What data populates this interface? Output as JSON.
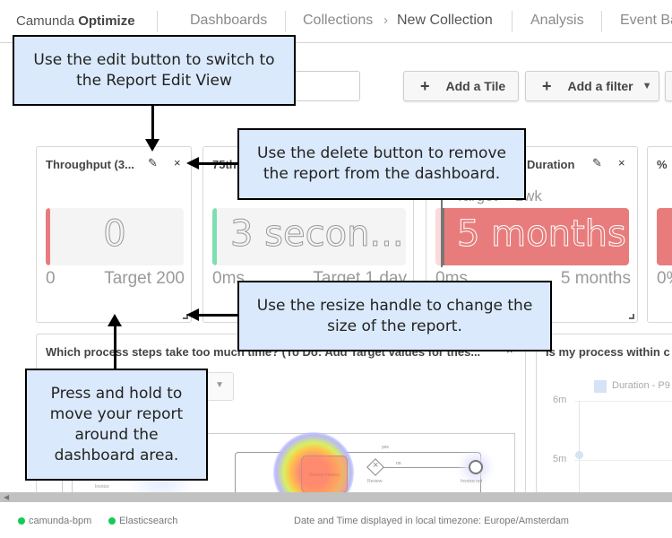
{
  "header": {
    "brand_regular": "Camunda",
    "brand_bold": "Optimize",
    "nav": {
      "dashboards": "Dashboards",
      "collections": "Collections",
      "breadcrumb_separator": "›",
      "current": "New Collection",
      "analysis": "Analysis",
      "event_based": "Event Ba"
    }
  },
  "toolbar": {
    "name_input_value": "",
    "add_tile_label": "Add a Tile",
    "add_filter_label": "Add a filter",
    "plus_icon": "+",
    "chevron_icon": "⌄"
  },
  "tiles": [
    {
      "title": "Throughput (3...",
      "value": "0",
      "low": "0",
      "high": "Target 200",
      "bar_color": "#e87c7c",
      "fill_color": "#f4f4f4"
    },
    {
      "title": "75th",
      "value": "3 secon...",
      "low": "0ms",
      "high": "Target 1 day",
      "bar_color": "#7bdfb1",
      "fill_color": "#f4f4f4"
    },
    {
      "title": "Duration",
      "target_label": "Target < 1wk",
      "value": "5 months",
      "low": "0ms",
      "high": "5 months",
      "bar_color": "#e87c7c",
      "fill_color": "#e87c7c"
    },
    {
      "title": "% ",
      "low": "0%",
      "bar_color": "#e87c7c"
    }
  ],
  "icons": {
    "edit": "✎",
    "close": "×"
  },
  "big_tiles": [
    {
      "title": "Which process steps take too much time? (To Do: Add Target values for thes...",
      "diagram": {
        "task_label": "Review Invoice",
        "gateway_label": "Review",
        "end_label": "Invoice not",
        "flow_yes": "yes",
        "flow_no": "no",
        "start_label": "Invoice"
      }
    },
    {
      "title": "Is my process within c",
      "legend": "Duration - P9",
      "y_ticks": [
        "6m",
        "5m"
      ]
    }
  ],
  "footer": {
    "status_1": "camunda-bpm",
    "status_2": "Elasticsearch",
    "status_color": "#16c95a",
    "timezone": "Date and Time displayed in local timezone: Europe/Amsterdam"
  },
  "callouts": {
    "edit": [
      "Use the edit button to switch to",
      "the Report Edit View"
    ],
    "delete": [
      "Use the delete button to remove",
      "the report from the dashboard."
    ],
    "resize": [
      "Use the resize handle to change the",
      "size of the report."
    ],
    "move": [
      "Press and hold to",
      "move your report",
      "around the",
      "dashboard area."
    ]
  }
}
